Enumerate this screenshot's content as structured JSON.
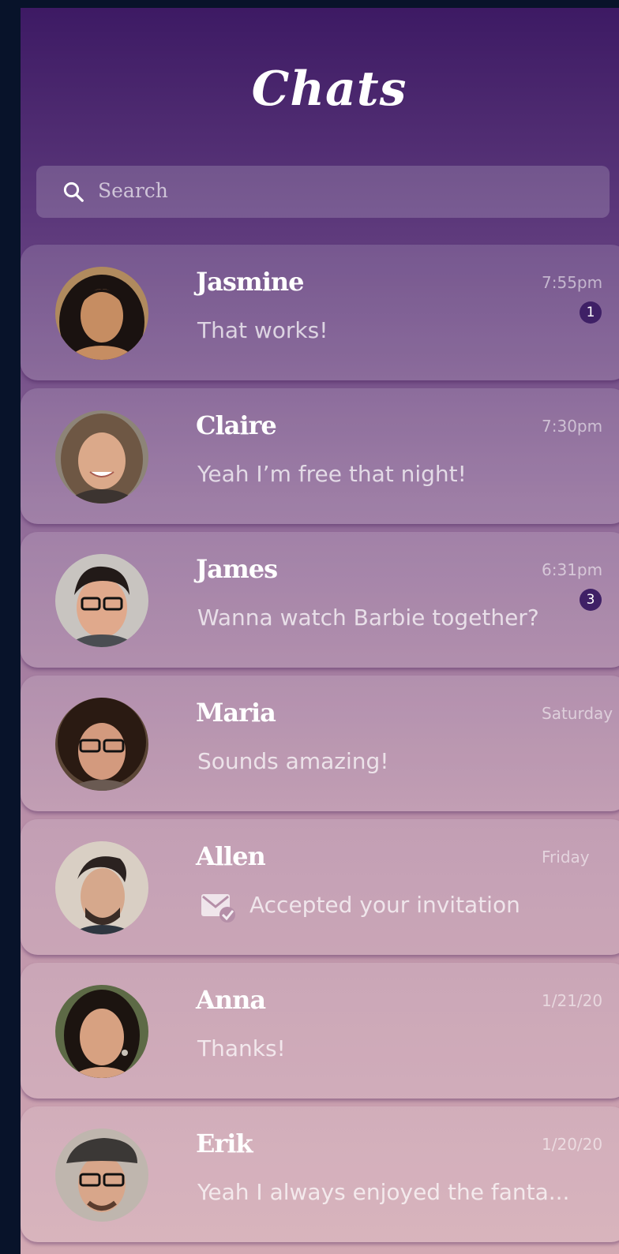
{
  "header": {
    "title": "Chats"
  },
  "search": {
    "placeholder": "Search",
    "icon": "search-icon"
  },
  "chats": [
    {
      "name": "Jasmine",
      "message": "That works!",
      "time": "7:55pm",
      "unread": "1"
    },
    {
      "name": "Claire",
      "message": "Yeah I’m free that night!",
      "time": "7:30pm",
      "unread": ""
    },
    {
      "name": "James",
      "message": "Wanna watch Barbie together?",
      "time": "6:31pm",
      "unread": "3"
    },
    {
      "name": "Maria",
      "message": "Sounds amazing!",
      "time": "Saturday",
      "unread": ""
    },
    {
      "name": "Allen",
      "message": "Accepted your invitation",
      "time": "Friday",
      "unread": "",
      "icon": "mail-check-icon"
    },
    {
      "name": "Anna",
      "message": "Thanks!",
      "time": "1/21/20",
      "unread": ""
    },
    {
      "name": "Erik",
      "message": "Yeah I always enjoyed the fanta...",
      "time": "1/20/20",
      "unread": ""
    }
  ]
}
